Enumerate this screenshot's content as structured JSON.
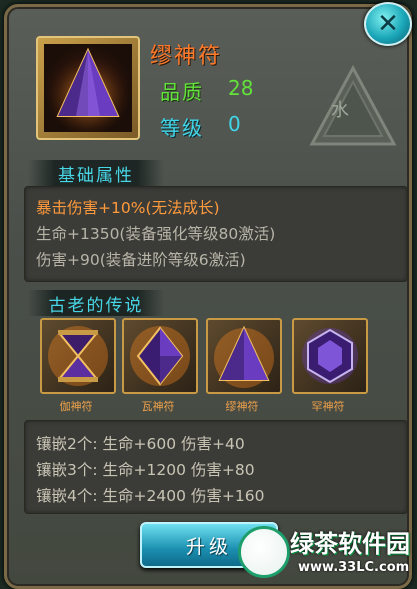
{
  "close_label": "✕",
  "item": {
    "name": "缪神符",
    "quality_label": "品质",
    "quality_value": "28",
    "level_label": "等级",
    "level_value": "0",
    "element": "水"
  },
  "basic_attributes": {
    "title": "基础属性",
    "lines": [
      "暴击伤害+10%(无法成长)",
      "生命+1350(装备强化等级80激活)",
      "伤害+90(装备进阶等级6激活)"
    ]
  },
  "legend_set": {
    "title": "古老的传说",
    "items": [
      {
        "label": "伽神符",
        "icon": "hourglass-rune-icon"
      },
      {
        "label": "瓦神符",
        "icon": "diamond-rune-icon"
      },
      {
        "label": "缪神符",
        "icon": "pyramid-rune-icon"
      },
      {
        "label": "罕神符",
        "icon": "hexagon-rune-icon"
      }
    ],
    "bonuses": [
      "镶嵌2个: 生命+600  伤害+40",
      "镶嵌3个: 生命+1200  伤害+80",
      "镶嵌4个: 生命+2400  伤害+160"
    ]
  },
  "upgrade_label": "升级",
  "watermark": {
    "name": "绿茶软件园",
    "url": "www.33LC.com"
  },
  "colors": {
    "name": "#ff7a2a",
    "quality": "#62e23a",
    "level": "#40d6e8",
    "highlight_attr": "#ff9a3c",
    "button": "#1b8fb0"
  }
}
